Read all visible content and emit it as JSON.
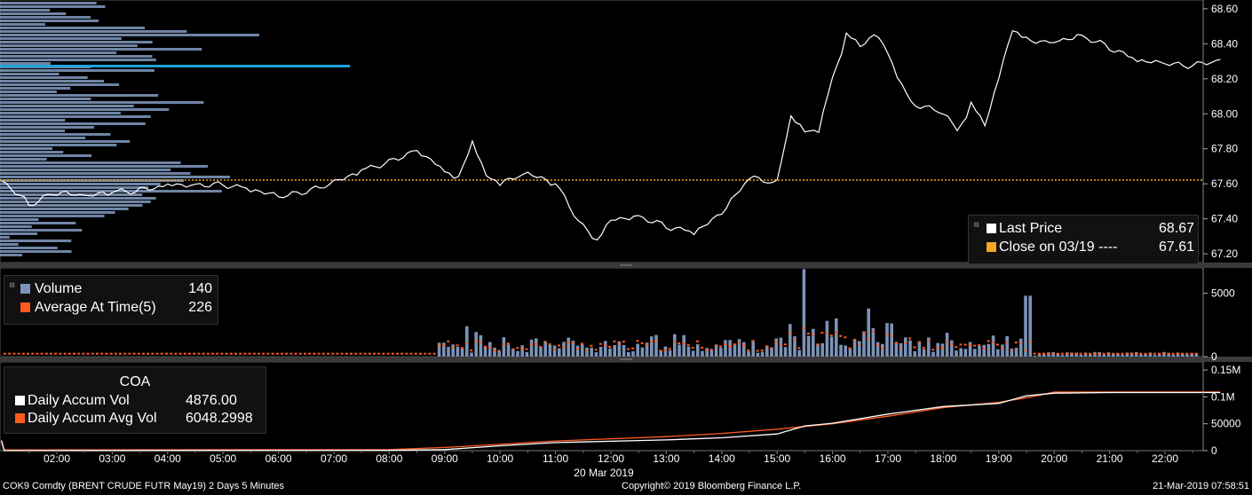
{
  "chart_data": [
    {
      "type": "line",
      "panel": "price",
      "x_unit": "time (2 days, 5 minute bars)",
      "y_ticks": [
        "67.20",
        "67.40",
        "67.60",
        "67.80",
        "68.00",
        "68.20",
        "68.40",
        "68.60"
      ],
      "ylim": [
        67.15,
        68.65
      ],
      "series": [
        {
          "name": "Last Price",
          "color": "#ffffff",
          "x": [
            "01:00",
            "01:30",
            "02:00",
            "02:30",
            "03:00",
            "03:30",
            "04:00",
            "04:30",
            "05:00",
            "05:30",
            "06:00",
            "06:30",
            "07:00",
            "07:30",
            "08:00",
            "08:30",
            "09:00",
            "09:15",
            "09:30",
            "09:45",
            "10:00",
            "10:30",
            "11:00",
            "11:30",
            "11:45",
            "12:00",
            "12:30",
            "13:00",
            "13:30",
            "14:00",
            "14:15",
            "14:30",
            "15:00",
            "15:15",
            "15:30",
            "15:45",
            "16:00",
            "16:15",
            "16:30",
            "16:45",
            "17:00",
            "17:15",
            "17:30",
            "18:00",
            "18:15",
            "18:30",
            "18:45",
            "19:00",
            "19:15",
            "19:30",
            "20:00",
            "20:30",
            "21:00",
            "21:30",
            "22:00",
            "22:30",
            "23:00"
          ],
          "y": [
            67.63,
            67.48,
            67.55,
            67.52,
            67.55,
            67.56,
            67.6,
            67.6,
            67.6,
            67.57,
            67.52,
            67.55,
            67.6,
            67.68,
            67.73,
            67.8,
            67.68,
            67.62,
            67.85,
            67.65,
            67.6,
            67.65,
            67.6,
            67.35,
            67.28,
            67.4,
            67.42,
            67.36,
            67.32,
            67.42,
            67.55,
            67.63,
            67.6,
            68.0,
            67.9,
            67.9,
            68.2,
            68.45,
            68.4,
            68.45,
            68.35,
            68.15,
            68.05,
            68.0,
            67.9,
            68.05,
            67.95,
            68.2,
            68.48,
            68.42,
            68.42,
            68.45,
            68.38,
            68.3,
            68.28,
            68.27,
            68.31
          ]
        },
        {
          "name": "Close on 03/19",
          "color": "#f5a623",
          "value": 67.61
        }
      ],
      "legend": [
        {
          "label": "Last Price",
          "value": "68.67"
        },
        {
          "label": "Close on 03/19 ---- ",
          "value": "67.61"
        }
      ],
      "volume_profile": "horizontal histogram on left (blue-grey bars, highlighted level ~68.25)"
    },
    {
      "type": "bar",
      "panel": "volume",
      "y_ticks": [
        "0",
        "5000"
      ],
      "ylim": [
        0,
        7000
      ],
      "series": [
        {
          "name": "Volume",
          "color": "#7b93b8"
        },
        {
          "name": "Average At Time(5)",
          "color": "#ff5a1f"
        }
      ],
      "legend": [
        {
          "label": "Volume",
          "value": "140"
        },
        {
          "label": "Average At Time(5)",
          "value": "226"
        }
      ]
    },
    {
      "type": "line",
      "panel": "daily_accum",
      "title": "COA",
      "y_ticks": [
        "0",
        "50000",
        "0.1M",
        "0.15M"
      ],
      "ylim": [
        0,
        165000
      ],
      "series": [
        {
          "name": "Daily Accum Vol",
          "color": "#ffffff"
        },
        {
          "name": "Daily Accum Avg Vol",
          "color": "#ff5a1f"
        }
      ],
      "legend": [
        {
          "label": "Daily Accum Vol",
          "value": "4876.00"
        },
        {
          "label": "Daily Accum Avg Vol",
          "value": "6048.2998"
        }
      ]
    }
  ],
  "x_axis": {
    "ticks": [
      "02:00",
      "03:00",
      "04:00",
      "05:00",
      "06:00",
      "07:00",
      "08:00",
      "09:00",
      "10:00",
      "11:00",
      "12:00",
      "13:00",
      "14:00",
      "15:00",
      "16:00",
      "17:00",
      "18:00",
      "19:00",
      "20:00",
      "21:00",
      "22:00"
    ],
    "date_label": "20 Mar 2019"
  },
  "footer": {
    "left": "COK9 Comdty (BRENT CRUDE FUTR  May19) 2 Days 5 Minutes",
    "center": "Copyright© 2019 Bloomberg Finance L.P.",
    "right": "21-Mar-2019 07:58:51"
  },
  "colors": {
    "background": "#000000",
    "volume_bar": "#7b93b8",
    "avg": "#ff5a1f",
    "close_line": "#f5a623",
    "highlight": "#1fa3d9"
  }
}
